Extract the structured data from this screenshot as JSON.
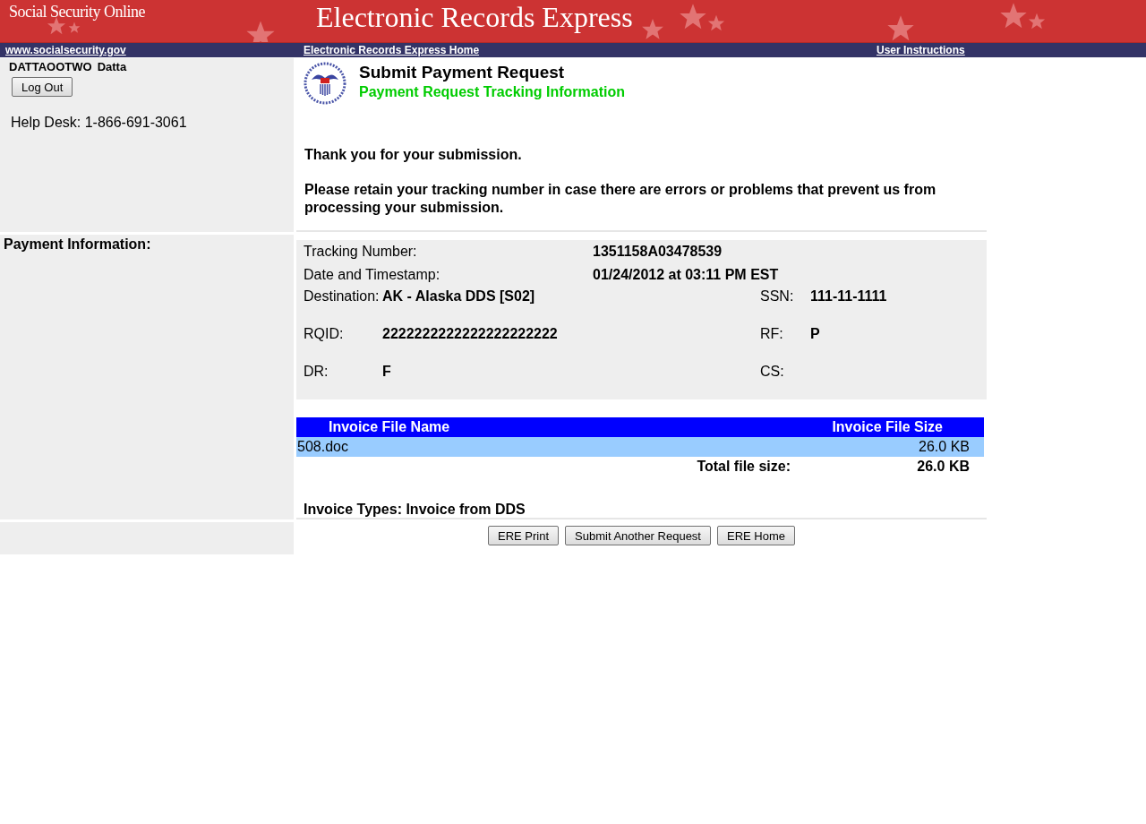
{
  "banner": {
    "site_name": "Social Security Online",
    "title": "Electronic Records Express"
  },
  "nav": [
    {
      "label": "www.socialsecurity.gov"
    },
    {
      "label": "Electronic Records Express Home"
    },
    {
      "label": "User Instructions"
    }
  ],
  "sidebar": {
    "username": "DATTAOOTWO",
    "name": "Datta",
    "logout_button": "Log Out",
    "help_desk": "Help Desk: 1-866-691-3061",
    "section_label": "Payment Information:"
  },
  "heading": {
    "title": "Submit Payment Request",
    "subtitle": "Payment Request Tracking Information"
  },
  "messages": [
    "Thank you for your submission.",
    "Please retain your tracking number in case there are errors or problems that prevent us from processing your submission."
  ],
  "details": {
    "top": [
      {
        "label": "Tracking Number:",
        "value": "1351158A03478539"
      },
      {
        "label": "Date and Timestamp:",
        "value": "01/24/2012 at 03:11 PM EST"
      }
    ],
    "rows": [
      [
        {
          "label": "Destination:",
          "value": "AK - Alaska DDS [S02]"
        },
        {
          "label": "SSN:",
          "value": "111-11-1111"
        }
      ],
      [
        {
          "label": "RQID:",
          "value": "2222222222222222222222"
        },
        {
          "label": "RF:",
          "value": "P"
        }
      ],
      [
        {
          "label": "DR:",
          "value": "F"
        },
        {
          "label": "CS:"
        }
      ]
    ]
  },
  "invoice_table": {
    "columns": [
      "Invoice File Name",
      "Invoice File Size"
    ],
    "rows": [
      {
        "name": "508.doc",
        "size": "26.0 KB"
      }
    ],
    "total": {
      "label": "Total file size:",
      "value": "26.0 KB"
    }
  },
  "invoice_types": "Invoice Types: Invoice from DDS",
  "buttons": [
    "ERE Print",
    "Submit Another Request",
    "ERE Home"
  ]
}
